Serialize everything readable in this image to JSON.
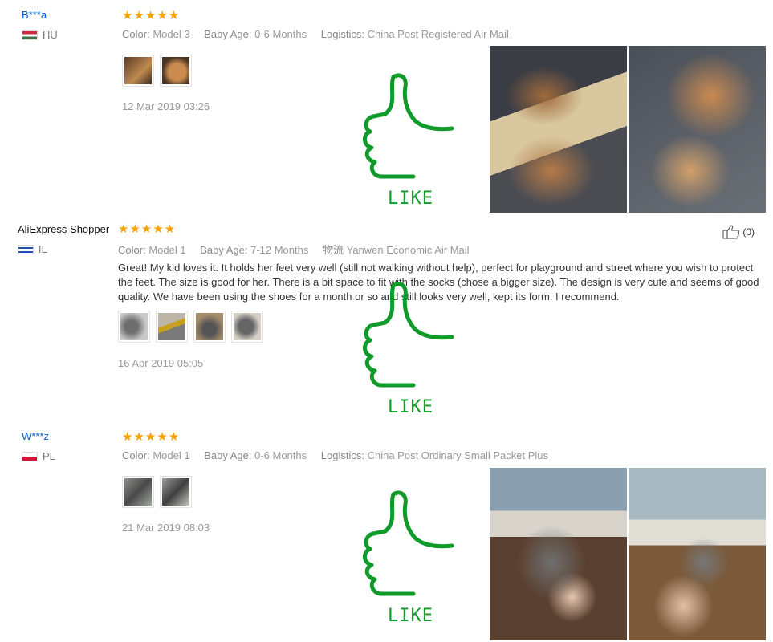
{
  "reviews": [
    {
      "user": "B***a",
      "country": "HU",
      "stars": "★★★★★",
      "color_label": "Color:",
      "color_value": "Model 3",
      "age_label": "Baby Age:",
      "age_value": "0-6 Months",
      "logistics_label": "Logistics:",
      "logistics_value": "China Post Registered Air Mail",
      "date": "12 Mar 2019 03:26",
      "like_word": "LIKE"
    },
    {
      "user": "AliExpress Shopper",
      "country": "IL",
      "stars": "★★★★★",
      "color_label": "Color:",
      "color_value": "Model 1",
      "age_label": "Baby Age:",
      "age_value": "7-12 Months",
      "logistics_label": "物流",
      "logistics_value": "Yanwen Economic Air Mail",
      "text": "Great! My kid loves it. It holds her feet very well (still not walking without help), perfect for playground and street where you wish to protect the feet. The size is good for her. There is a bit space to fit with the socks (chose a bigger size). The design is very cute and seems of good quality. We have been using the shoes for a month or so and still looks very well, kept its form. I recommend.",
      "date": "16 Apr 2019 05:05",
      "helpful_count": "(0)",
      "like_word": "LIKE"
    },
    {
      "user": "W***z",
      "country": "PL",
      "stars": "★★★★★",
      "color_label": "Color:",
      "color_value": "Model 1",
      "age_label": "Baby Age:",
      "age_value": "0-6 Months",
      "logistics_label": "Logistics:",
      "logistics_value": "China Post Ordinary Small Packet Plus",
      "date": "21 Mar 2019 08:03",
      "like_word": "LIKE"
    }
  ],
  "colors": {
    "star": "#f5a100",
    "like_green": "#0f9a2a",
    "username_blue": "#0b5ed7"
  }
}
